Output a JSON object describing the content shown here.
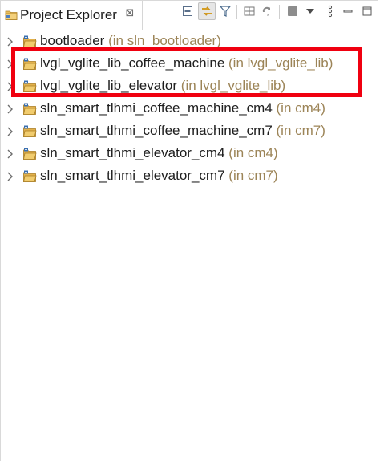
{
  "view": {
    "title": "Project Explorer",
    "title_icon": "folder-icon",
    "close_glyph": "⊠"
  },
  "toolbar": {
    "buttons": [
      {
        "name": "collapse-all-icon"
      },
      {
        "name": "link-with-editor-icon"
      },
      {
        "name": "filter-icon"
      },
      {
        "name": "group-by-icon"
      },
      {
        "name": "sync-icon"
      },
      {
        "name": "stop-icon"
      },
      {
        "name": "view-menu-icon"
      },
      {
        "name": "more-options-icon"
      },
      {
        "name": "minimize-icon"
      },
      {
        "name": "maximize-icon"
      }
    ]
  },
  "tree": {
    "items": [
      {
        "name": "bootloader",
        "context": "(in sln_bootloader)",
        "icon": "project-folder-icon"
      },
      {
        "name": "lvgl_vglite_lib_coffee_machine",
        "context": "(in lvgl_vglite_lib)",
        "icon": "project-folder-icon"
      },
      {
        "name": "lvgl_vglite_lib_elevator",
        "context": "(in lvgl_vglite_lib)",
        "icon": "project-folder-icon"
      },
      {
        "name": "sln_smart_tlhmi_coffee_machine_cm4",
        "context": "(in cm4)",
        "icon": "project-folder-icon"
      },
      {
        "name": "sln_smart_tlhmi_coffee_machine_cm7",
        "context": "(in cm7)",
        "icon": "project-folder-icon"
      },
      {
        "name": "sln_smart_tlhmi_elevator_cm4",
        "context": "(in cm4)",
        "icon": "project-folder-icon"
      },
      {
        "name": "sln_smart_tlhmi_elevator_cm7",
        "context": "(in cm7)",
        "icon": "project-folder-icon"
      }
    ]
  },
  "colors": {
    "highlight": "#f00010",
    "context_text": "#9c8457",
    "folder": "#e2b14c",
    "folder_badge": "#3a6fb0"
  }
}
